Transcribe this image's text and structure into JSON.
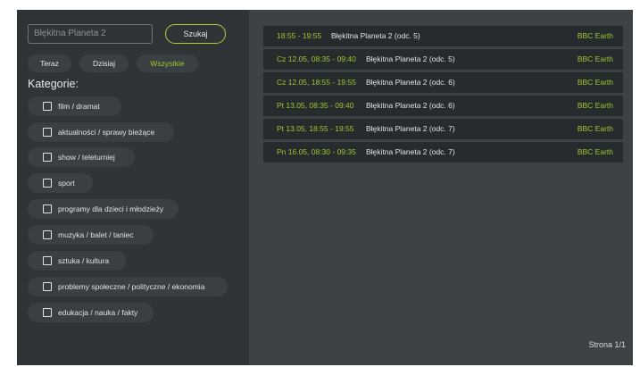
{
  "search": {
    "value": "Błękitna Planeta 2",
    "button_label": "Szukaj"
  },
  "filters": [
    {
      "label": "Teraz",
      "active": false
    },
    {
      "label": "Dzisiaj",
      "active": false
    },
    {
      "label": "Wszystkie",
      "active": true
    }
  ],
  "categories": {
    "title": "Kategorie:",
    "items": [
      {
        "label": "film / dramat",
        "checked": false
      },
      {
        "label": "aktualności / sprawy bieżące",
        "checked": false
      },
      {
        "label": "show / teleturniej",
        "checked": false
      },
      {
        "label": "sport",
        "checked": false
      },
      {
        "label": "programy dla dzieci i młodzieży",
        "checked": false
      },
      {
        "label": "muzyka / balet / taniec",
        "checked": false
      },
      {
        "label": "sztuka / kultura",
        "checked": false
      },
      {
        "label": "problemy społeczne / polityczne / ekonomia",
        "checked": false
      },
      {
        "label": "edukacja / nauka / fakty",
        "checked": false
      }
    ]
  },
  "results": [
    {
      "time": "18:55 - 19:55",
      "title": "Błękitna Planeta 2 (odc. 5)",
      "channel": "BBC Earth"
    },
    {
      "time": "Cz 12.05, 08:35 - 09:40",
      "title": "Błękitna Planeta 2 (odc. 5)",
      "channel": "BBC Earth"
    },
    {
      "time": "Cz 12.05, 18:55 - 19:55",
      "title": "Błękitna Planeta 2 (odc. 6)",
      "channel": "BBC Earth"
    },
    {
      "time": "Pt 13.05, 08:35 - 09:40",
      "title": "Błękitna Planeta 2 (odc. 6)",
      "channel": "BBC Earth"
    },
    {
      "time": "Pt 13.05, 18:55 - 19:55",
      "title": "Błękitna Planeta 2 (odc. 7)",
      "channel": "BBC Earth"
    },
    {
      "time": "Pn 16.05, 08:30 - 09:35",
      "title": "Błękitna Planeta 2 (odc. 7)",
      "channel": "BBC Earth"
    }
  ],
  "pagination": {
    "label": "Strona 1/1"
  },
  "colors": {
    "accent": "#9fc92f",
    "panel": "#2f3436",
    "background": "#3d4244",
    "row": "#262b2d"
  }
}
